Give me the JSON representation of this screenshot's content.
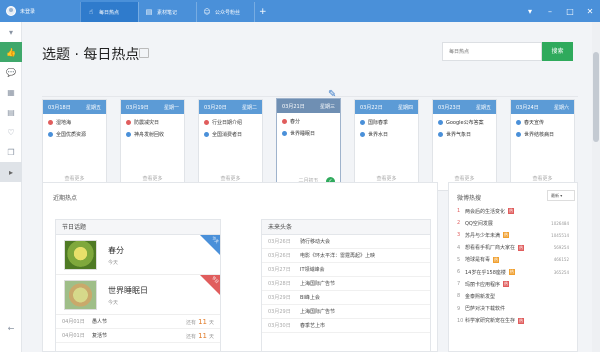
{
  "titlebar": {
    "user_name": "未登录",
    "tabs": [
      {
        "label": "每日热点",
        "icon": "hand-pointer-icon"
      },
      {
        "label": "素材笔记",
        "icon": "notebook-icon"
      },
      {
        "label": "公众号粉丝",
        "icon": "users-icon"
      }
    ],
    "add_tab": "+",
    "window_controls": [
      "▾",
      "–",
      "□",
      "✕"
    ]
  },
  "sidebar": {
    "items": [
      {
        "icon": "chevron-down-icon",
        "glyph": "▾"
      },
      {
        "icon": "thumb-up-icon",
        "glyph": "👍"
      },
      {
        "icon": "chat-icon",
        "glyph": "💬"
      },
      {
        "icon": "table-icon",
        "glyph": "▦"
      },
      {
        "icon": "document-icon",
        "glyph": "▤"
      },
      {
        "icon": "like-icon",
        "glyph": "♡"
      },
      {
        "icon": "copy-icon",
        "glyph": "❐"
      },
      {
        "icon": "expand-icon",
        "glyph": "▸"
      }
    ],
    "back_glyph": "←"
  },
  "header": {
    "title": "选题 · 每日热点",
    "search_placeholder": "每日热点",
    "search_button": "搜索"
  },
  "days": [
    {
      "date": "03月18日",
      "weekday": "星期五",
      "events": [
        {
          "text": "湿地海",
          "color": "red"
        },
        {
          "text": "全国优质资源",
          "color": "blue"
        }
      ],
      "more": "查看更多"
    },
    {
      "date": "03月19日",
      "weekday": "星期一",
      "events": [
        {
          "text": "防震减灾日",
          "color": "red"
        },
        {
          "text": "神舟发射回收",
          "color": "blue"
        }
      ],
      "more": "查看更多"
    },
    {
      "date": "03月20日",
      "weekday": "星期二",
      "events": [
        {
          "text": "行业日期介绍",
          "color": "red"
        },
        {
          "text": "全国消费者日",
          "color": "blue"
        }
      ],
      "more": "查看更多"
    },
    {
      "date": "03月21日",
      "weekday": "星期三",
      "events": [
        {
          "text": "春分",
          "color": "red"
        },
        {
          "text": "世界睡眠日",
          "color": "blue"
        }
      ],
      "more": "二月初五",
      "check": "✓"
    },
    {
      "date": "03月22日",
      "weekday": "星期四",
      "events": [
        {
          "text": "国际春季",
          "color": "blue"
        },
        {
          "text": "世界水日",
          "color": "blue"
        }
      ],
      "more": "查看更多"
    },
    {
      "date": "03月23日",
      "weekday": "星期五",
      "events": [
        {
          "text": "Google公布答案",
          "color": "blue"
        },
        {
          "text": "世界气象日",
          "color": "blue"
        }
      ],
      "more": "查看更多"
    },
    {
      "date": "03月24日",
      "weekday": "星期六",
      "events": [
        {
          "text": "春天宣传",
          "color": "blue"
        },
        {
          "text": "世界结核病日",
          "color": "blue"
        }
      ],
      "more": "查看更多"
    }
  ],
  "recent": {
    "title": "近期热点",
    "festival": {
      "header": "节日话题",
      "items": [
        {
          "name": "春分",
          "days": "今天",
          "ribbon": "今天",
          "ribbon_color": "blue"
        },
        {
          "name": "世界睡眠日",
          "days": "今天",
          "ribbon": "节日",
          "ribbon_color": "red"
        }
      ],
      "list": [
        {
          "date": "04月01日",
          "name": "愚人节",
          "prefix": "还有",
          "num": "11",
          "suffix": "天"
        },
        {
          "date": "04月01日",
          "name": "复活节",
          "prefix": "还有",
          "num": "11",
          "suffix": "天"
        }
      ]
    },
    "headlines": {
      "header": "未来头条",
      "items": [
        {
          "date": "03月26日",
          "text": "骑行移动大会"
        },
        {
          "date": "03月26日",
          "text": "电影《环太平洋：雷霆再起》上映"
        },
        {
          "date": "03月27日",
          "text": "IT领域峰会"
        },
        {
          "date": "03月28日",
          "text": "上海国际广告节"
        },
        {
          "date": "03月29日",
          "text": "BI峰上会"
        },
        {
          "date": "03月29日",
          "text": "上海国际广告节"
        },
        {
          "date": "03月30日",
          "text": "春季艺上市"
        }
      ]
    }
  },
  "weibo": {
    "title": "微博热搜",
    "select": "最新",
    "items": [
      {
        "rank": "1",
        "title": "两会后的生活变化",
        "tag": "热",
        "count": ""
      },
      {
        "rank": "2",
        "title": "QQ空间发展",
        "tag": "",
        "count": "1026484"
      },
      {
        "rank": "3",
        "title": "苏丹与少年未满",
        "tag": "热",
        "count": "1045514"
      },
      {
        "rank": "4",
        "title": "想看看手机厂商大家在",
        "tag": "热",
        "count": "569254"
      },
      {
        "rank": "5",
        "title": "地球是有毒",
        "tag": "热",
        "count": "466152"
      },
      {
        "rank": "6",
        "title": "14岁在乎158座楼",
        "tag": "热",
        "count": "365254"
      },
      {
        "rank": "7",
        "title": "玛丽卡应用程序",
        "tag": "热",
        "count": ""
      },
      {
        "rank": "8",
        "title": "金泰熙新发型",
        "tag": "",
        "count": ""
      },
      {
        "rank": "9",
        "title": "巴萨对决下载软件",
        "tag": "",
        "count": ""
      },
      {
        "rank": "10",
        "title": "科学家研究新宠在生存",
        "tag": "热",
        "count": ""
      }
    ]
  },
  "colors": {
    "titlebar": "#4a90d9",
    "accent_green": "#2faa5c",
    "event_red": "#e05d5d",
    "event_blue": "#4a90d9"
  }
}
